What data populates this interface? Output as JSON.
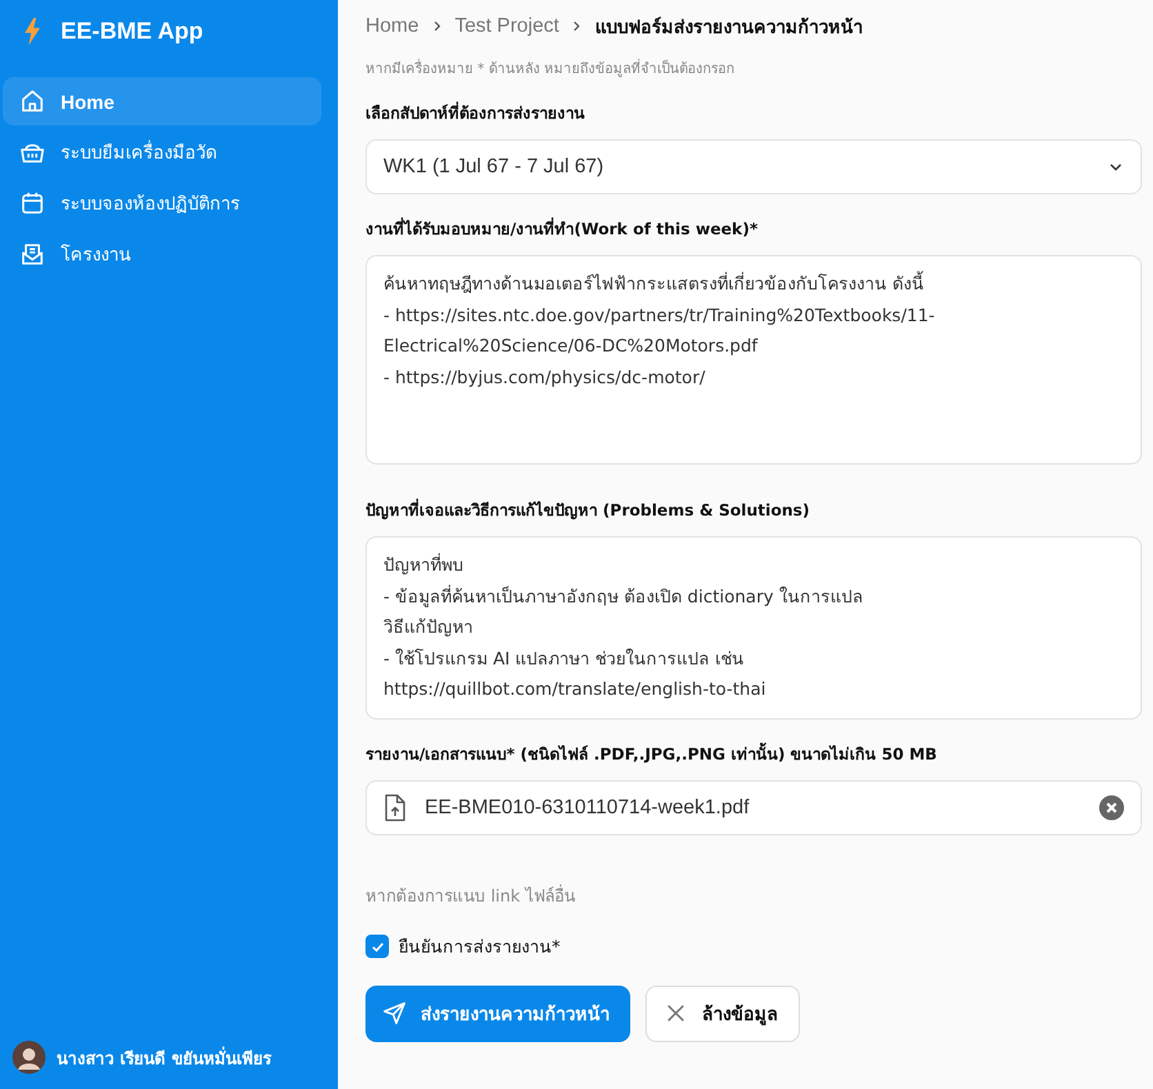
{
  "app": {
    "title": "EE-BME App"
  },
  "sidebar": {
    "items": [
      {
        "label": "Home",
        "selected": true
      },
      {
        "label": "ระบบยืมเครื่องมือวัด",
        "selected": false
      },
      {
        "label": "ระบบจองห้องปฏิบัติการ",
        "selected": false
      },
      {
        "label": "โครงงาน",
        "selected": false
      }
    ],
    "user": {
      "name": "นางสาว เรียนดี ขยันหมั่นเพียร"
    }
  },
  "breadcrumb": [
    "Home",
    "Test Project",
    "แบบฟอร์มส่งรายงานความก้าวหน้า"
  ],
  "note": "หากมีเครื่องหมาย * ด้านหลัง หมายถึงข้อมูลที่จำเป็นต้องกรอก",
  "week": {
    "label": "เลือกสัปดาห์ที่ต้องการส่งรายงาน",
    "value": "WK1 (1 Jul 67 - 7 Jul 67)"
  },
  "work": {
    "label": "งานที่ได้รับมอบหมาย/งานที่ทำ(Work of this week)*",
    "value": "ค้นหาทฤษฎีทางด้านมอเตอร์ไฟฟ้ากระแสตรงที่เกี่ยวข้องกับโครงงาน ดังนี้\n- https://sites.ntc.doe.gov/partners/tr/Training%20Textbooks/11-Electrical%20Science/06-DC%20Motors.pdf\n- https://byjus.com/physics/dc-motor/"
  },
  "problems": {
    "label": "ปัญหาที่เจอและวิธีการแก้ไขปัญหา (Problems & Solutions)",
    "value": "ปัญหาที่พบ\n- ข้อมูลที่ค้นหาเป็นภาษาอังกฤษ ต้องเปิด dictionary ในการแปล\nวิธีแก้ปัญหา\n- ใช้โปรแกรม AI แปลภาษา ช่วยในการแปล เช่น\nhttps://quillbot.com/translate/english-to-thai"
  },
  "attachment": {
    "label": "รายงาน/เอกสารแนบ* (ชนิดไฟล์ .PDF,.JPG,.PNG เท่านั้น) ขนาดไม่เกิน 50 MB",
    "file": "EE-BME010-6310110714-week1.pdf"
  },
  "link_hint": "หากต้องการแนบ link ไฟล์อื่น",
  "confirm": {
    "label": "ยืนยันการส่งรายงาน*",
    "checked": true
  },
  "buttons": [
    {
      "label": "ส่งรายงานความก้าวหน้า",
      "kind": "primary"
    },
    {
      "label": "ล้างข้อมูล",
      "kind": "secondary"
    }
  ]
}
